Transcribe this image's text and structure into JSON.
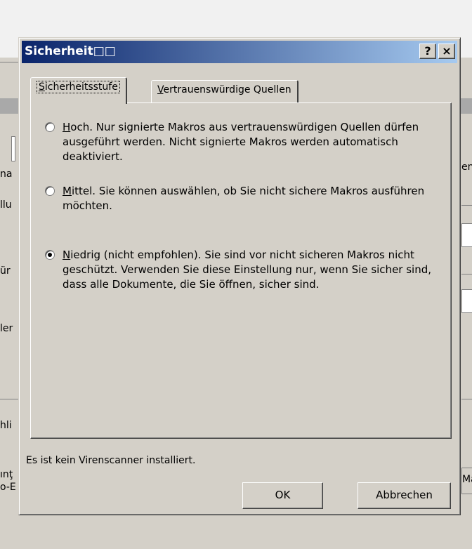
{
  "dialog": {
    "title": "Sicherheit□□",
    "help_button": "?",
    "close_button": "×",
    "tabs": [
      {
        "label_underlined": "S",
        "label_rest": "icherheitsstufe",
        "active": true
      },
      {
        "label_underlined": "V",
        "label_rest": "ertrauenswürdige Quellen",
        "active": false
      }
    ],
    "options": [
      {
        "underlined": "H",
        "rest": "och. Nur signierte Makros aus vertrauenswürdigen Quellen dürfen ausgeführt werden.  Nicht signierte Makros werden automatisch deaktiviert.",
        "checked": false
      },
      {
        "underlined": "M",
        "rest": "ittel. Sie können auswählen, ob Sie nicht sichere Makros ausführen möchten.",
        "checked": false
      },
      {
        "underlined": "N",
        "rest": "iedrig (nicht empfohlen). Sie sind vor nicht sicheren Makros nicht geschützt. Verwenden Sie diese Einstellung nur, wenn Sie sicher sind, dass alle Dokumente, die Sie öffnen, sicher sind.",
        "checked": true
      }
    ],
    "status_text": "Es ist kein Virenscanner installiert.",
    "ok_label": "OK",
    "cancel_label": "Abbrechen"
  },
  "background": {
    "fragments": [
      "na",
      "llu",
      "ür",
      "ler",
      "hli",
      "ınţ",
      "o-E",
      "en",
      "Ma"
    ]
  },
  "colors": {
    "face": "#d4d0c8",
    "title_start": "#0a246a",
    "title_end": "#a6caf0"
  }
}
